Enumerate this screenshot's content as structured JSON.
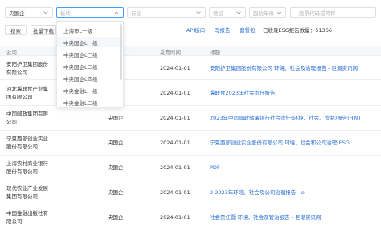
{
  "filters": {
    "category": "央国企",
    "search_placeholder": "板块",
    "industry_placeholder": "行业",
    "region_placeholder": "地区",
    "start_placeholder": "起始年份",
    "stock_placeholder": "股票代码或简称"
  },
  "actions": {
    "search": "搜索",
    "batch_download": "批量下载"
  },
  "links": [
    "API接口",
    "写报告",
    "套餐包"
  ],
  "total_label": "已收录ESG报告数量：",
  "total_value": "51366",
  "table": {
    "headers": [
      "公司",
      "发布时间",
      "标题"
    ],
    "rows": [
      {
        "company": "安阳护卫集团股份有限公司",
        "type": "",
        "date": "2024-01-01",
        "title": "安阳护卫集团股份有限公司 环境、社会及治理报告 - 巨潮资讯网"
      },
      {
        "company": "河北冀联食产业集团有限公司",
        "type": "",
        "date": "2024-01-01",
        "title": "冀联食2023年社会责任报告"
      },
      {
        "company": "中国邮政集团有限公司",
        "type": "央国企",
        "date": "2024-01-01",
        "title": "2023年中国邮政储蓄银行社会责任(环境、社会、管制)报告(H股)"
      },
      {
        "company": "宁夏西部创业实业股份有限公司",
        "type": "央国企",
        "date": "2024-01-01",
        "title": "宁夏西部创业实业股份有限公司 环境、社会和公司治理(ESG..."
      },
      {
        "company": "上海农村商业银行股份有限公司",
        "type": "央国企",
        "date": "2024-01-01",
        "title": "PDF"
      },
      {
        "company": "现代农业产业发展集团有限公司",
        "type": "央国企",
        "date": "2024-01-01",
        "title": "2 2023年环境、社会及公司治理报告 - e"
      },
      {
        "company": "中国金融出版社有限公司",
        "type": "央国企",
        "date": "2024-01-01",
        "title": "社会责任暨 环境、社会及管治报告 - 巨潮资讯网"
      }
    ]
  },
  "dropdown": {
    "items": [
      "上海市L一级",
      "中央国企L一级",
      "中央国企L三级",
      "中央国企L二级",
      "中央国企L四级",
      "中央金融L一级",
      "中央金融L二级"
    ],
    "highlighted_index": 1
  },
  "colors": {
    "link": "#2a6fd6",
    "active_border": "#409eff"
  }
}
